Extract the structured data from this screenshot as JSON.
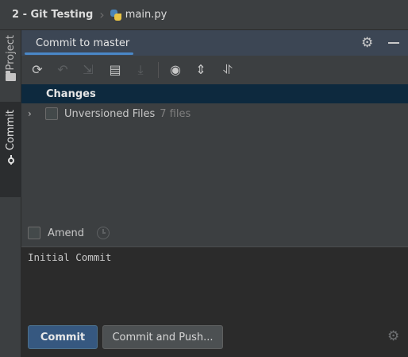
{
  "breadcrumb": {
    "project": "2 - Git Testing",
    "file": "main.py"
  },
  "sidebar": {
    "items": [
      {
        "label": "Project",
        "icon": "folder-icon"
      },
      {
        "label": "Commit",
        "icon": "commit-icon"
      }
    ]
  },
  "panel": {
    "tab_label": "Commit to master",
    "icons": [
      "gear-icon",
      "minimize-icon"
    ]
  },
  "toolbar": {
    "icons": [
      "refresh-icon",
      "rollback-icon",
      "merge-arrows-icon",
      "diff-icon",
      "shelve-icon",
      "eye-icon",
      "expand-all-icon",
      "collapse-all-icon"
    ]
  },
  "changes": {
    "header": "Changes",
    "group_label": "Unversioned Files",
    "group_count": "7 files"
  },
  "amend": {
    "label": "Amend"
  },
  "message": {
    "text": "Initial Commit"
  },
  "buttons": {
    "commit": "Commit",
    "commit_push": "Commit and Push..."
  },
  "colors": {
    "accent": "#4a88c7",
    "selection": "#0d293e",
    "primary_button": "#365880"
  }
}
